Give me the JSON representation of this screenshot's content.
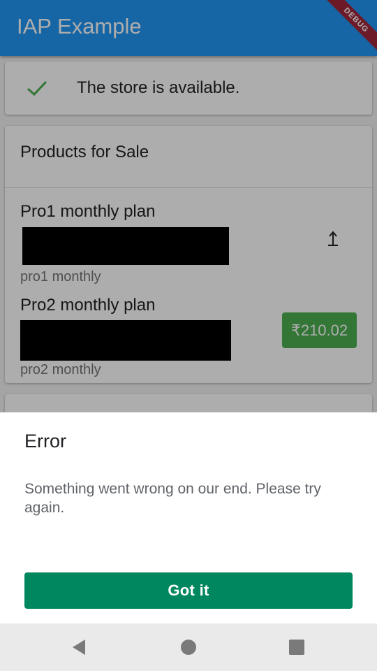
{
  "appbar": {
    "title": "IAP Example",
    "debug_label": "DEBUG"
  },
  "status": {
    "icon": "check-icon",
    "text": "The store is available."
  },
  "products": {
    "title": "Products for Sale",
    "items": [
      {
        "title": "Pro1 monthly plan",
        "subtitle": "pro1 monthly",
        "action_icon": "upgrade-icon"
      },
      {
        "title": "Pro2 monthly plan",
        "subtitle": "pro2 monthly",
        "price": "₹210.02"
      }
    ]
  },
  "dialog": {
    "title": "Error",
    "message": "Something went wrong on our end. Please try again.",
    "button_label": "Got it"
  },
  "navbar": {
    "icons": [
      "back-icon",
      "home-icon",
      "recents-icon"
    ]
  },
  "colors": {
    "primary": "#2196f3",
    "success": "#4caf50",
    "dialog_button": "#01875f",
    "debug": "#a1273b"
  }
}
